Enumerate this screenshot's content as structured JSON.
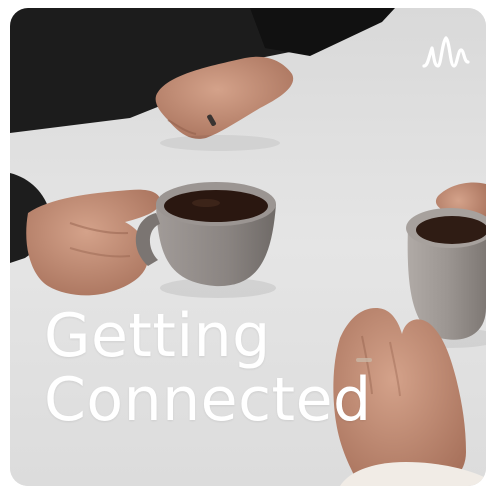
{
  "cover": {
    "title_line1": "Getting",
    "title_line2": "Connected",
    "logo_icon": "podcast-waveform-icon"
  },
  "colors": {
    "title": "#ffffff",
    "table": "#e2e2e2",
    "sleeve": "#1b1b1b",
    "skin": "#c9967f",
    "mug_left": "#8d8784",
    "mug_right": "#9a9491",
    "coffee": "#2a1710"
  }
}
